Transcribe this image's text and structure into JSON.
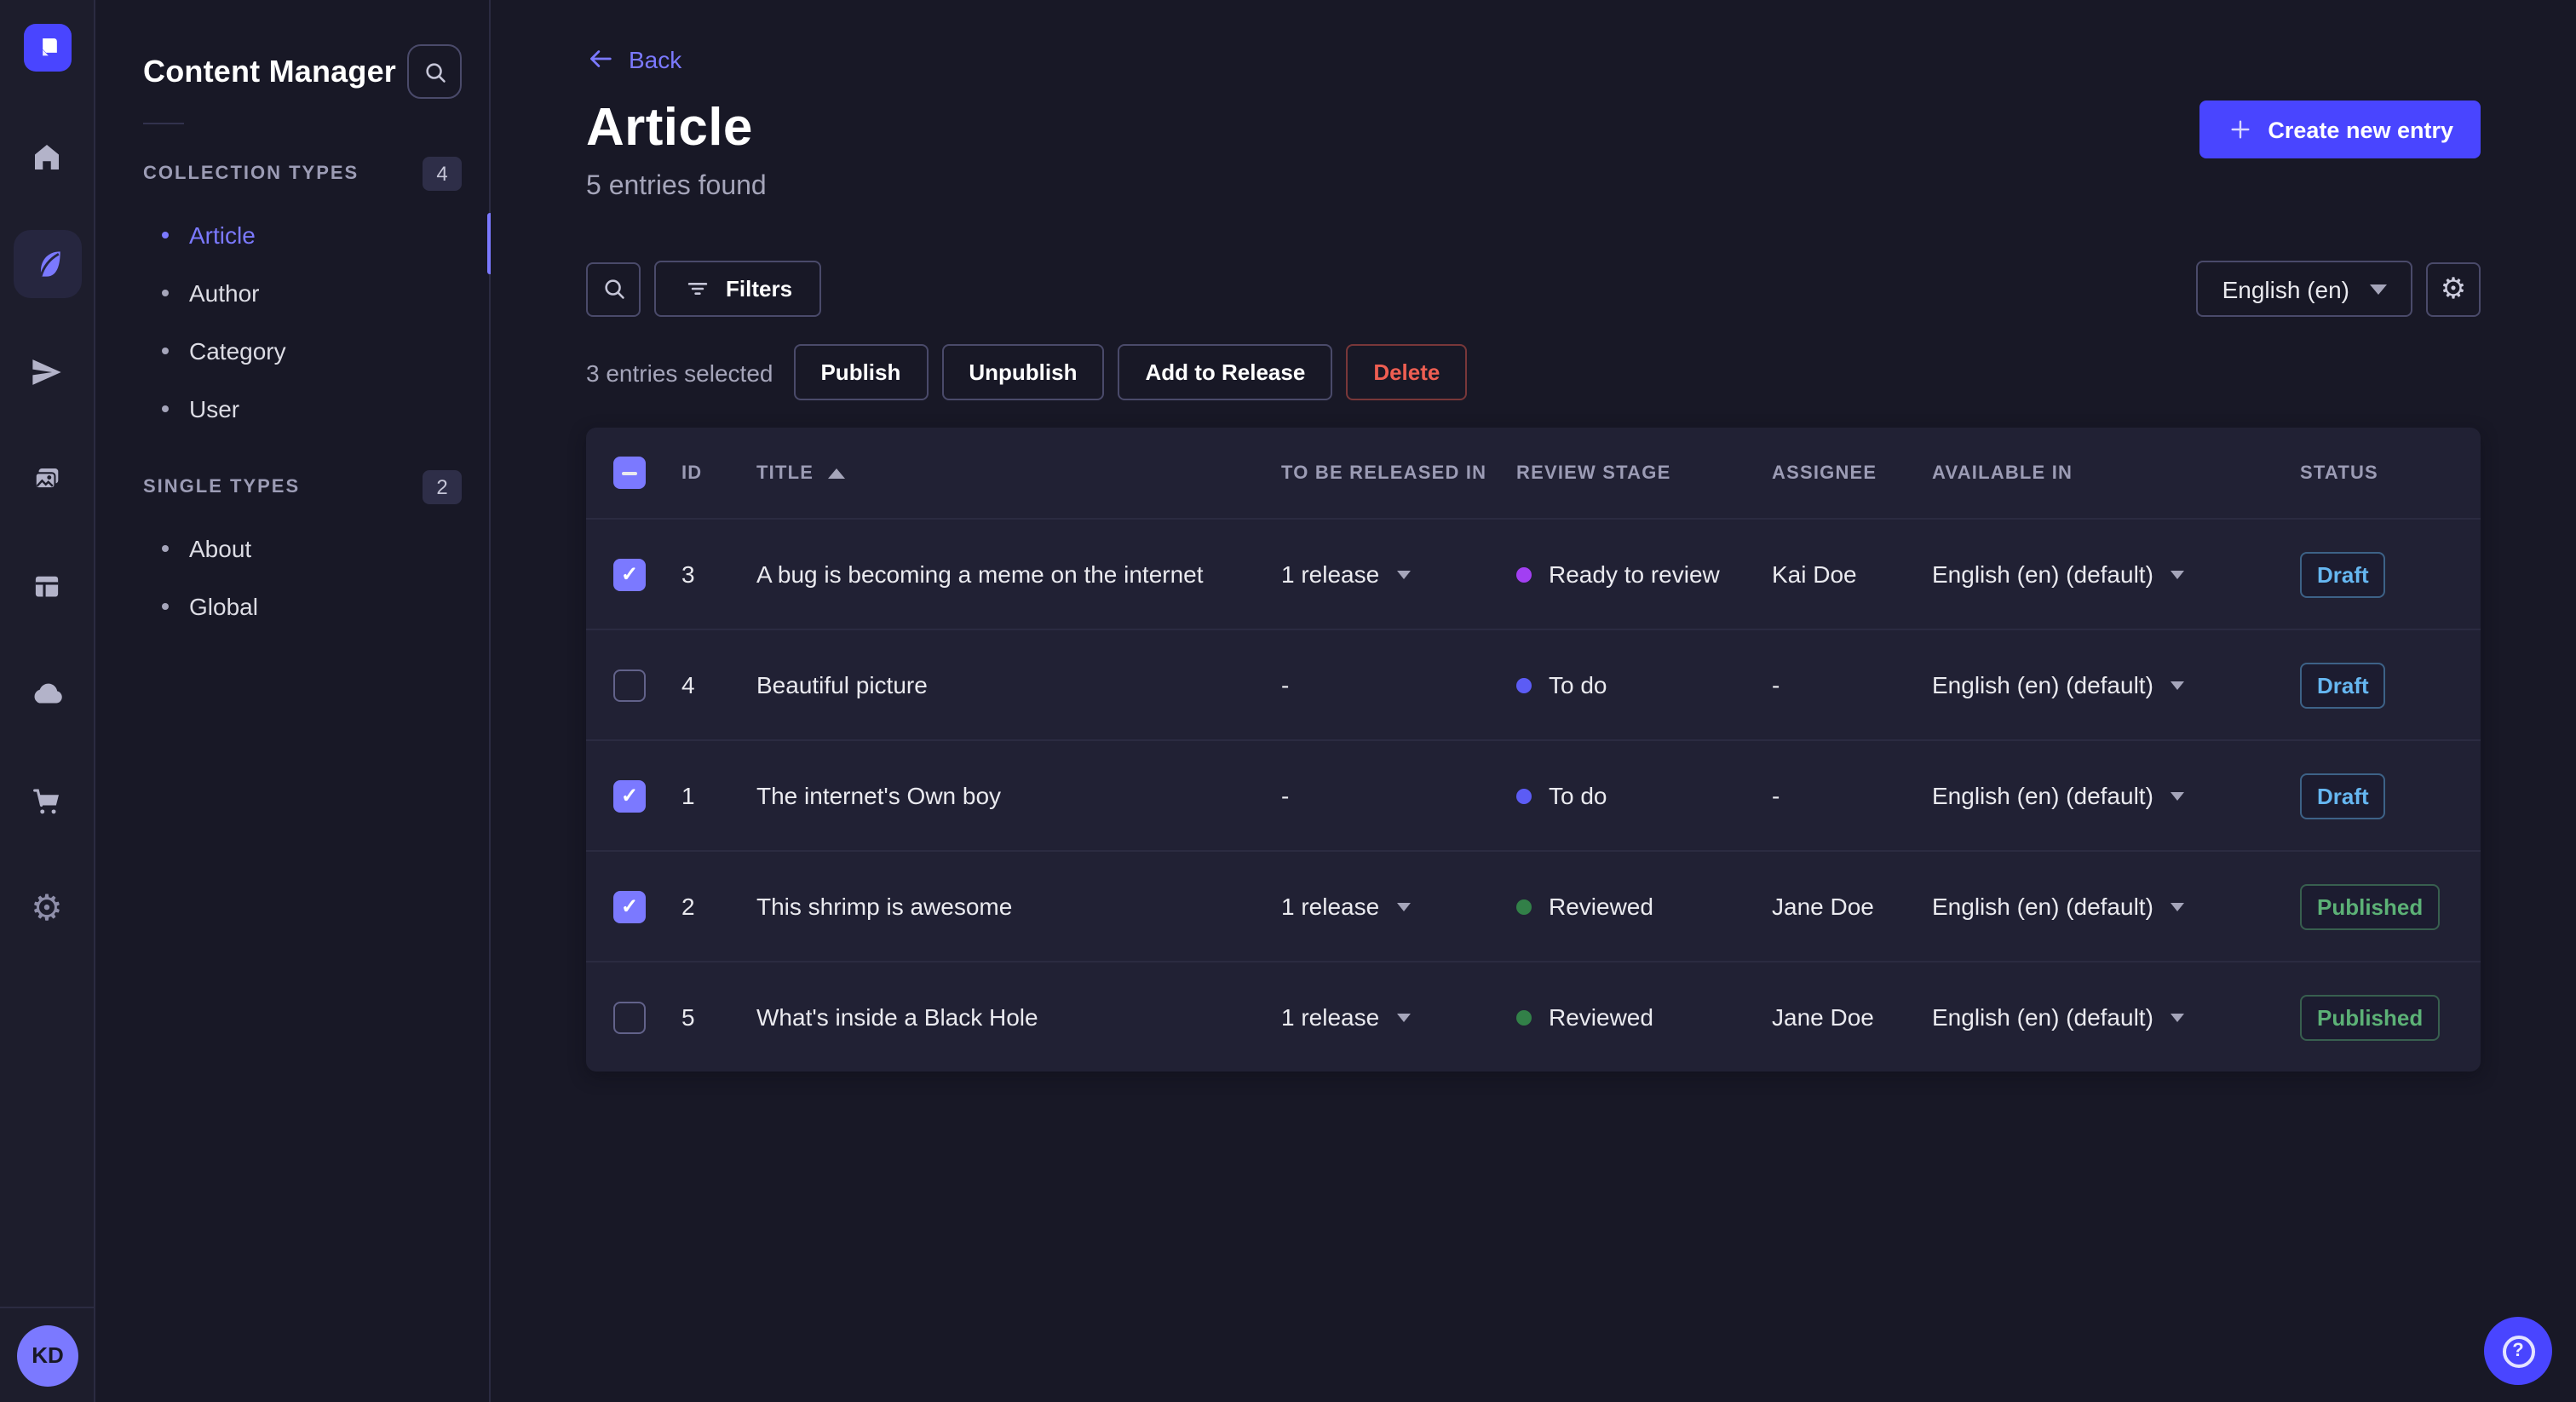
{
  "colors": {
    "brand": "#4945ff",
    "brand_light": "#7b79ff",
    "bg": "#181826",
    "card": "#212134",
    "danger": "#ee5e52",
    "draft": "#66b7f1",
    "published": "#5cb176",
    "stage_todo": "#5c5cf5",
    "stage_ready": "#a23ff2",
    "stage_reviewed": "#328048"
  },
  "rail": {
    "logo": "strapi-logo",
    "icons": [
      "home",
      "content-feather",
      "releases-paper-plane",
      "media-library",
      "content-type-layout",
      "deploy-cloud",
      "marketplace-cart",
      "settings-gear"
    ],
    "avatar": "KD"
  },
  "subnav": {
    "title": "Content Manager",
    "search_icon": "search",
    "sections": [
      {
        "label": "COLLECTION TYPES",
        "count": "4",
        "items": [
          {
            "label": "Article",
            "active": true
          },
          {
            "label": "Author"
          },
          {
            "label": "Category"
          },
          {
            "label": "User"
          }
        ]
      },
      {
        "label": "SINGLE TYPES",
        "count": "2",
        "items": [
          {
            "label": "About"
          },
          {
            "label": "Global"
          }
        ]
      }
    ]
  },
  "header": {
    "back": "Back",
    "title": "Article",
    "subtitle": "5 entries found",
    "create_button": "Create new entry"
  },
  "toolbar": {
    "filters": "Filters",
    "locale": "English (en)"
  },
  "selection": {
    "text": "3 entries selected",
    "actions": [
      "Publish",
      "Unpublish",
      "Add to Release",
      "Delete"
    ]
  },
  "table": {
    "columns": [
      "ID",
      "TITLE",
      "TO BE RELEASED IN",
      "REVIEW STAGE",
      "ASSIGNEE",
      "AVAILABLE IN",
      "STATUS"
    ],
    "sorted_column": "TITLE",
    "sort_direction": "ascending",
    "rows": [
      {
        "checked": true,
        "id": "3",
        "title": "A bug is becoming a meme on the internet",
        "release": "1 release",
        "stage": "Ready to review",
        "stage_color": "#a23ff2",
        "assignee": "Kai Doe",
        "locale": "English (en) (default)",
        "status": "Draft"
      },
      {
        "checked": false,
        "id": "4",
        "title": "Beautiful picture",
        "release": "-",
        "stage": "To do",
        "stage_color": "#5c5cf5",
        "assignee": "-",
        "locale": "English (en) (default)",
        "status": "Draft"
      },
      {
        "checked": true,
        "id": "1",
        "title": "The internet's Own boy",
        "release": "-",
        "stage": "To do",
        "stage_color": "#5c5cf5",
        "assignee": "-",
        "locale": "English (en) (default)",
        "status": "Draft"
      },
      {
        "checked": true,
        "id": "2",
        "title": "This shrimp is awesome",
        "release": "1 release",
        "stage": "Reviewed",
        "stage_color": "#328048",
        "assignee": "Jane Doe",
        "locale": "English (en) (default)",
        "status": "Published"
      },
      {
        "checked": false,
        "id": "5",
        "title": "What's inside a Black Hole",
        "release": "1 release",
        "stage": "Reviewed",
        "stage_color": "#328048",
        "assignee": "Jane Doe",
        "locale": "English (en) (default)",
        "status": "Published"
      }
    ]
  },
  "help": {
    "icon": "question-mark"
  }
}
